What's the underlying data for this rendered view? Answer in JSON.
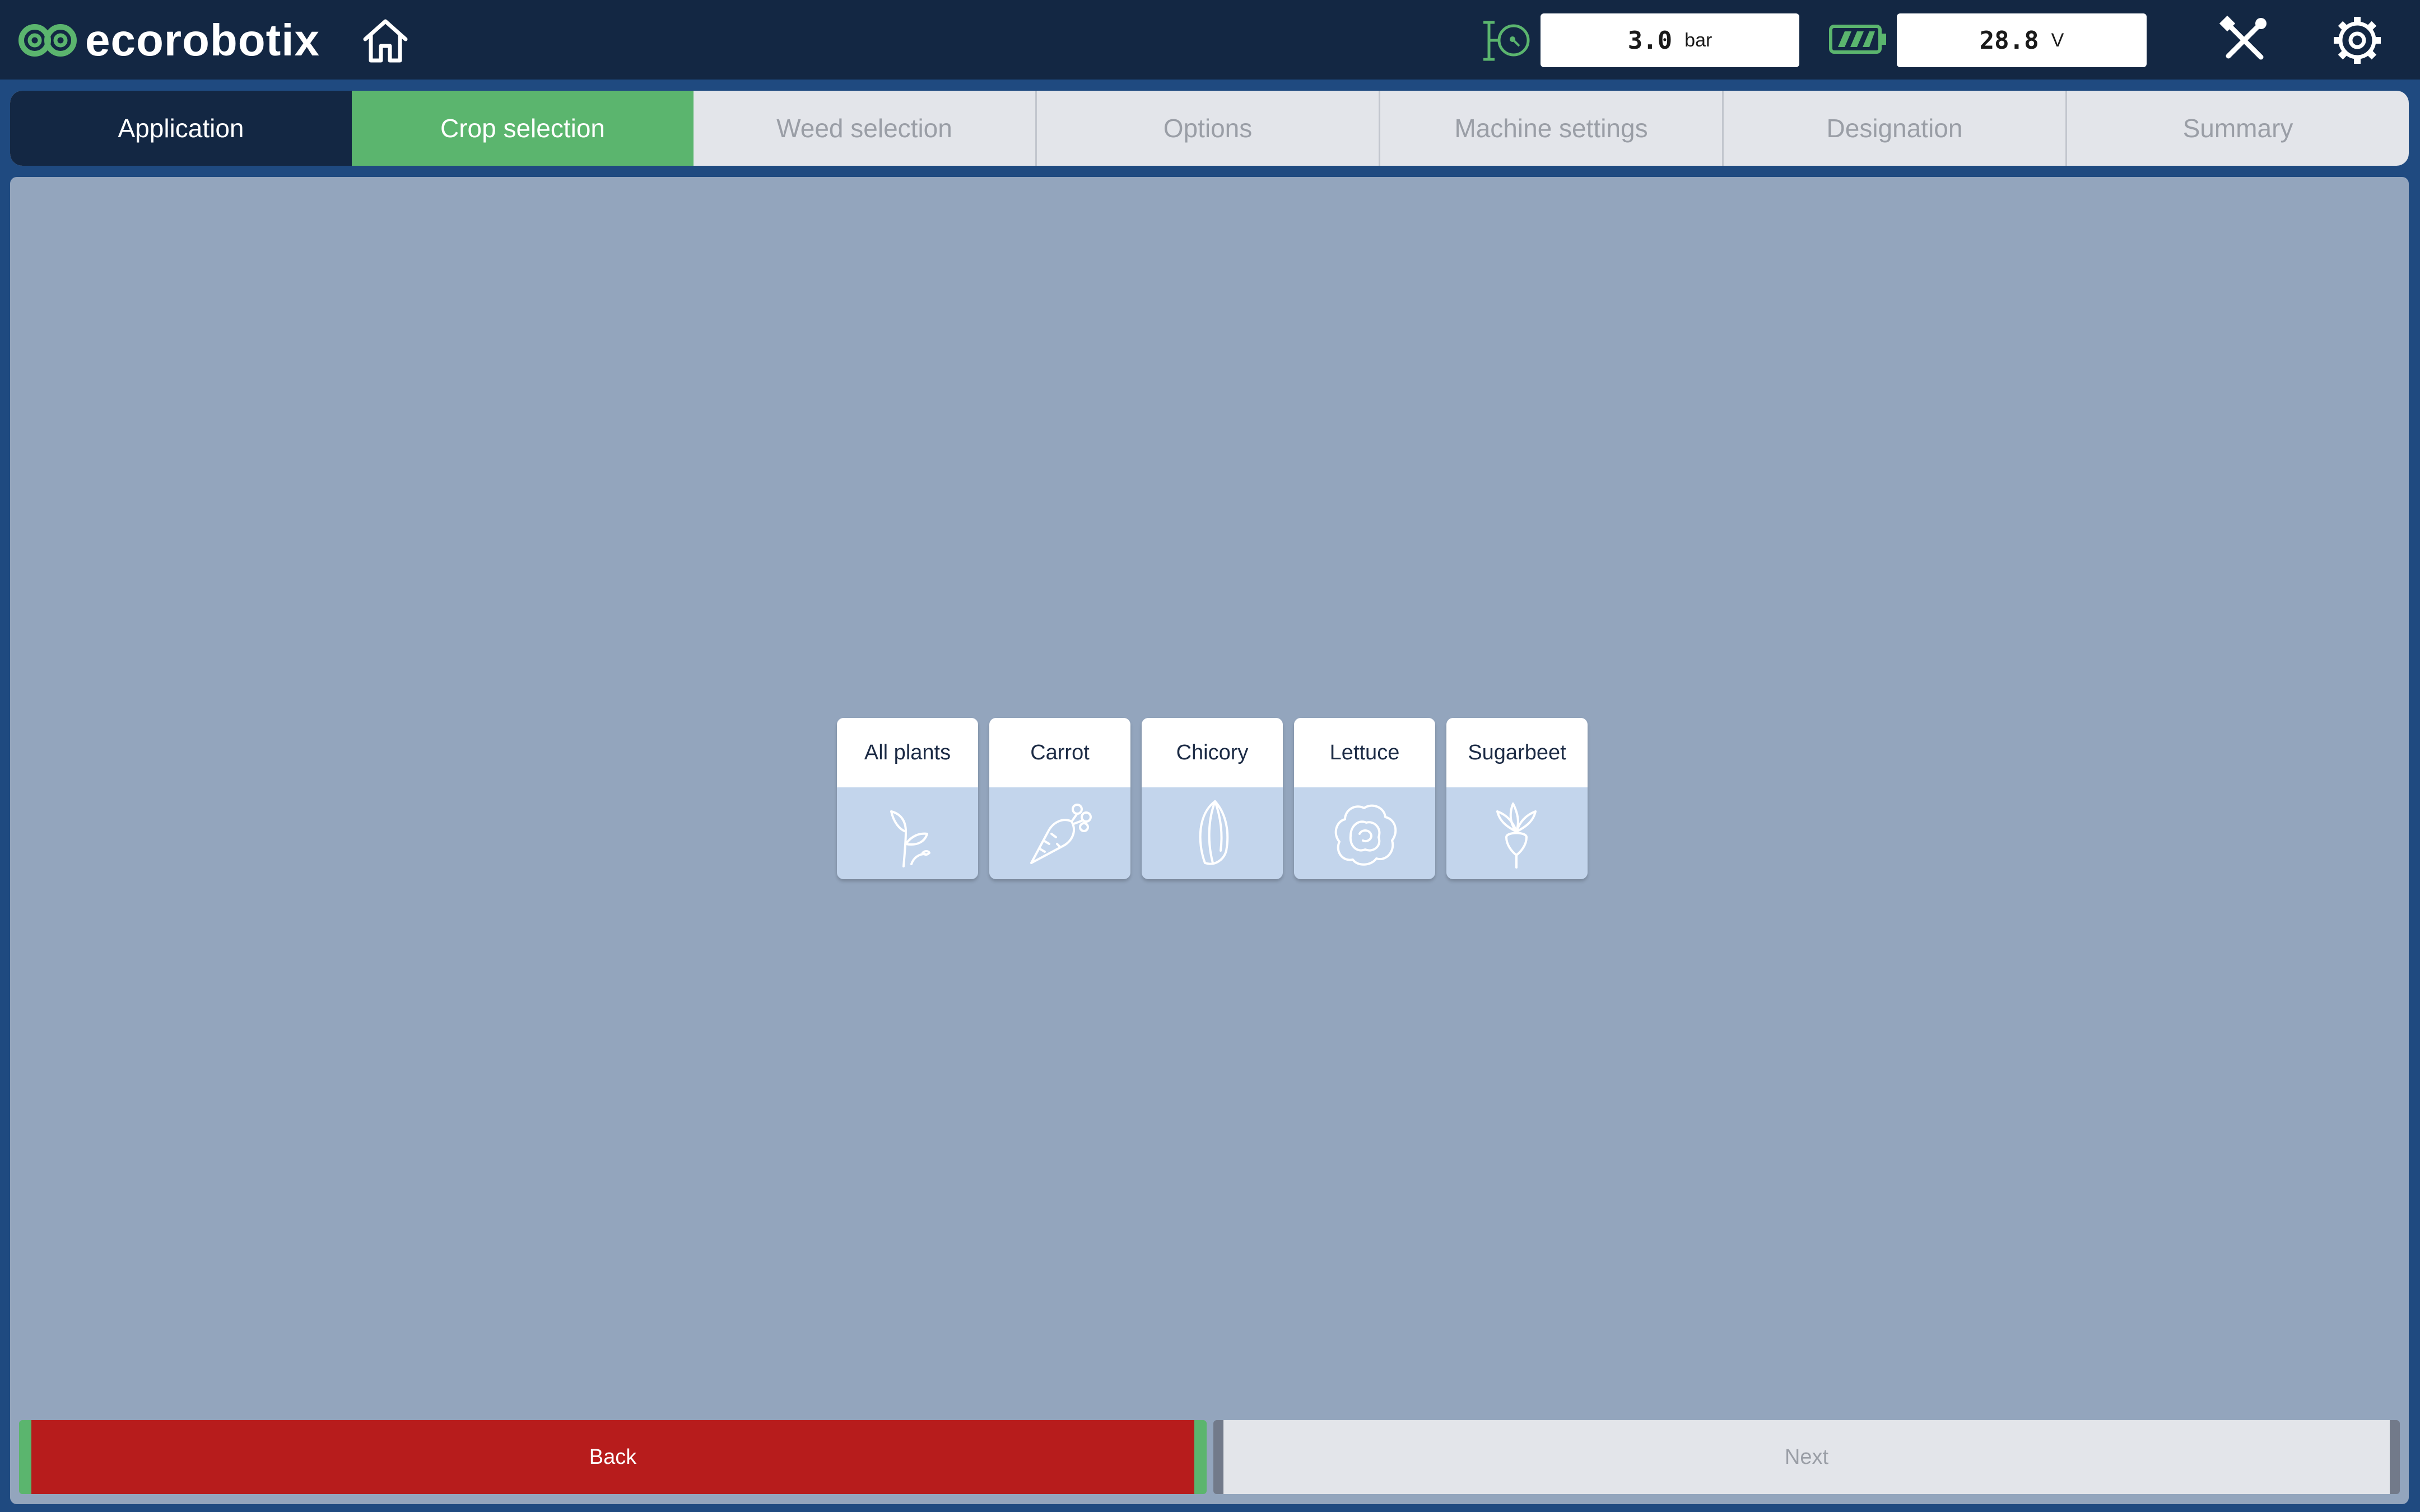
{
  "header": {
    "logo_text": "ecorobotix",
    "pressure": {
      "value": "3.0",
      "unit": "bar"
    },
    "voltage": {
      "value": "28.8",
      "unit": "V"
    }
  },
  "tabs": [
    {
      "label": "Application",
      "state": "done"
    },
    {
      "label": "Crop selection",
      "state": "active"
    },
    {
      "label": "Weed selection",
      "state": "disabled"
    },
    {
      "label": "Options",
      "state": "disabled"
    },
    {
      "label": "Machine settings",
      "state": "disabled"
    },
    {
      "label": "Designation",
      "state": "disabled"
    },
    {
      "label": "Summary",
      "state": "disabled"
    }
  ],
  "crops": [
    {
      "label": "All plants",
      "icon": "seedling-icon"
    },
    {
      "label": "Carrot",
      "icon": "carrot-icon"
    },
    {
      "label": "Chicory",
      "icon": "chicory-icon"
    },
    {
      "label": "Lettuce",
      "icon": "lettuce-icon"
    },
    {
      "label": "Sugarbeet",
      "icon": "sugarbeet-icon"
    }
  ],
  "footer": {
    "back_label": "Back",
    "next_label": "Next"
  },
  "colors": {
    "header_bg": "#132743",
    "accent_green": "#5bb56e",
    "back_red": "#b71c1c",
    "content_bg": "#93a5bd"
  }
}
